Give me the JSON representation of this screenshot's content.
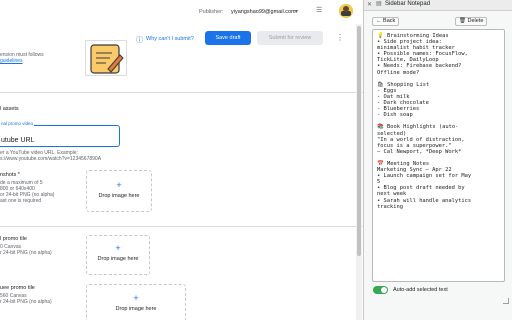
{
  "header": {
    "publisher_label": "Publisher:",
    "publisher_email": "yiyangshao99@gmail.com",
    "why_cant_submit": "Why can't I submit?",
    "save_draft": "Save draft",
    "submit_review": "Submit for review"
  },
  "content": {
    "policy_line1": "ension must follows",
    "policy_link": "guidelines",
    "graphic_assets": "l assets",
    "promo_video_label": "nal promo video",
    "promo_video_value": "utube URL",
    "promo_help1": "er a YouTube video URL. Example:",
    "promo_help2": "s://www.youtube.com/watch?v=1234567890A",
    "screenshots_title": "nshots *",
    "screenshots_sub1": "de a maximum of 5",
    "screenshots_sub2": "800 or 640x400",
    "screenshots_sub3": "or 24-bit PNG (no alpha)",
    "screenshots_sub4": "ast one is required",
    "drop_label": "Drop image here",
    "plus": "+",
    "small_promo_title": "l promo tile",
    "small_promo_sub1": "0 Canvas",
    "small_promo_sub2": "r 24-bit PNG (no alpha)",
    "marquee_title": "uee promo tile",
    "marquee_sub1": "560 Canvas",
    "marquee_sub2": "r 24-bit PNG (no alpha)"
  },
  "panel": {
    "title": "Sidebar Notepad",
    "back_label": "← Back",
    "delete_label": "🗑 Delete",
    "notes_text": "💡 Brainstorming Ideas\n• Side project idea:\nminimalist habit tracker\n• Possible names: FocusFlow,\nTickLite, DailyLoop\n• Needs: Firebase backend?\nOffline mode?\n\n🛍 Shopping List\n- Eggs\n- Oat milk\n- Dark chocolate\n- Blueberries\n- Dish soap\n\n📚 Book Highlights (auto-\nselected)\n\"In a world of distraction,\nfocus is a superpower.\"\n— Cal Newport, *Deep Work*\n\n📅 Meeting Notes\nMarketing Sync — Apr 22\n• Launch campaign set for May\n5\n• Blog post draft needed by\nnext week\n• Sarah will handle analytics\ntracking",
    "auto_add_label": "Auto-add selected text"
  },
  "colors": {
    "accent_blue": "#1a73e8",
    "toggle_green": "#34a853"
  }
}
